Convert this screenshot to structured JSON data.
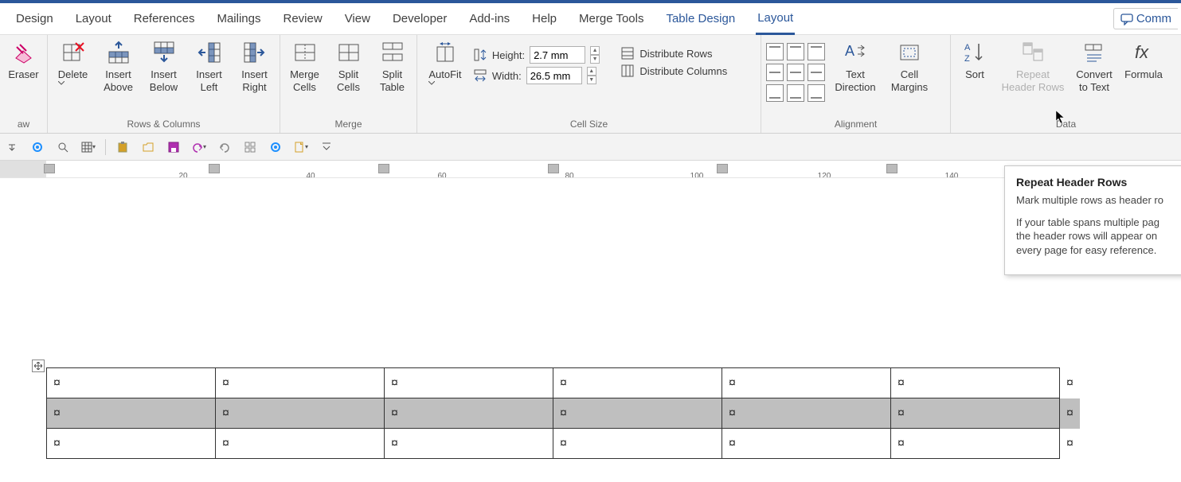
{
  "tabs": {
    "design": "Design",
    "layout1": "Layout",
    "references": "References",
    "mailings": "Mailings",
    "review": "Review",
    "view": "View",
    "developer": "Developer",
    "addins": "Add-ins",
    "help": "Help",
    "mergetools": "Merge Tools",
    "tabledesign": "Table Design",
    "layout2": "Layout",
    "comments": "Comm"
  },
  "groups": {
    "draw": "aw",
    "rowscols": "Rows & Columns",
    "merge": "Merge",
    "cellsize": "Cell Size",
    "alignment": "Alignment",
    "data": "Data"
  },
  "buttons": {
    "eraser": "Eraser",
    "delete": "Delete",
    "insert_above": "Insert\nAbove",
    "insert_below": "Insert\nBelow",
    "insert_left": "Insert\nLeft",
    "insert_right": "Insert\nRight",
    "merge_cells": "Merge\nCells",
    "split_cells": "Split\nCells",
    "split_table": "Split\nTable",
    "autofit": "AutoFit",
    "height_lbl": "Height:",
    "width_lbl": "Width:",
    "height_val": "2.7 mm",
    "width_val": "26.5 mm",
    "dist_rows": "Distribute Rows",
    "dist_cols": "Distribute Columns",
    "text_dir": "Text\nDirection",
    "cell_margins": "Cell\nMargins",
    "sort": "Sort",
    "repeat_header": "Repeat\nHeader Rows",
    "convert": "Convert\nto Text",
    "formula": "Formula"
  },
  "ruler": {
    "t20": "20",
    "t40": "40",
    "t60": "60",
    "t80": "80",
    "t100": "100",
    "t120": "120",
    "t140": "140"
  },
  "tooltip": {
    "title": "Repeat Header Rows",
    "line1": "Mark multiple rows as header ro",
    "line2": "If your table spans multiple pag",
    "line3": "the header rows will appear on",
    "line4": "every page for easy reference."
  },
  "cell_mark": "¤"
}
